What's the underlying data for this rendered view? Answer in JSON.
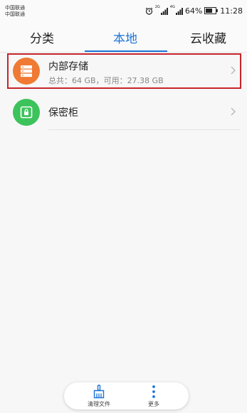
{
  "status_bar": {
    "carrier_1": "中国联通",
    "carrier_2": "中国联通",
    "network_1": "2G",
    "network_2": "4G",
    "battery": "64%",
    "time": "11:28"
  },
  "tabs": [
    {
      "label": "分类",
      "active": false
    },
    {
      "label": "本地",
      "active": true
    },
    {
      "label": "云收藏",
      "active": false
    }
  ],
  "list": [
    {
      "title": "内部存储",
      "subtitle": "总共：64 GB，可用：27.38 GB",
      "icon": "storage-icon",
      "icon_color": "#f07a33",
      "highlighted": true
    },
    {
      "title": "保密柜",
      "icon": "safe-icon",
      "icon_color": "#3cc35b"
    }
  ],
  "bottom_bar": {
    "clean_label": "清理文件",
    "more_label": "更多"
  },
  "colors": {
    "accent": "#1e74d6",
    "highlight_border": "#c7242c"
  }
}
